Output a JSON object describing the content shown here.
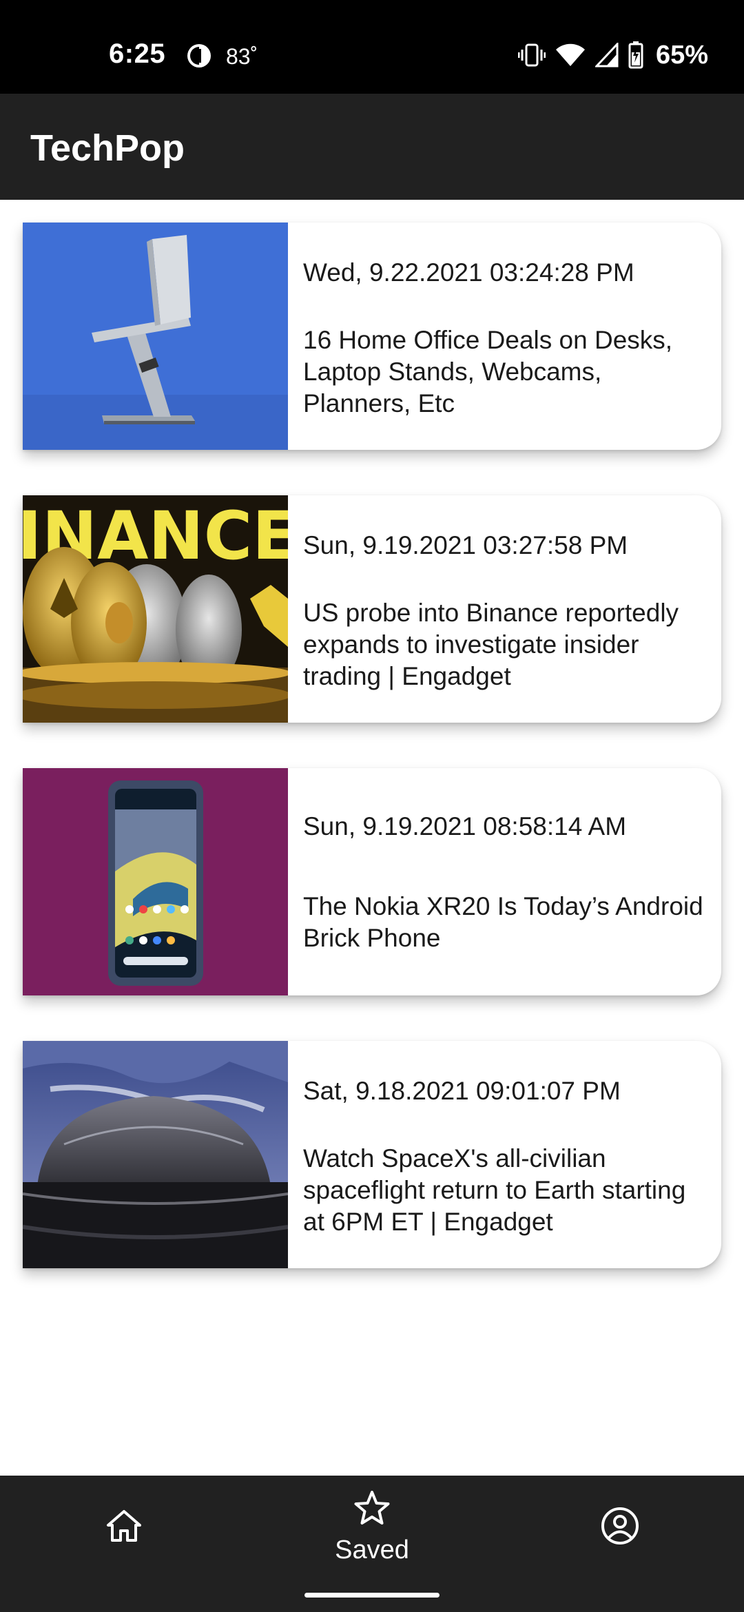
{
  "status_bar": {
    "time": "6:25",
    "temperature": "83˚",
    "battery_percent": "65%",
    "icons": [
      "weather-icon",
      "vibrate-icon",
      "wifi-icon",
      "signal-icon",
      "battery-icon"
    ]
  },
  "app_bar": {
    "title": "TechPop"
  },
  "articles": [
    {
      "date": "Wed, 9.22.2021 03:24:28 PM",
      "title": "16 Home Office Deals on Desks, Laptop Stands, Webcams, Planners, Etc",
      "thumbnail": "laptop-stand-image"
    },
    {
      "date": "Sun, 9.19.2021 03:27:58 PM",
      "title": "US probe into Binance reportedly expands to investigate insider trading | Engadget",
      "thumbnail": "binance-crypto-coins-image",
      "thumbnail_text": "INANCE"
    },
    {
      "date": "Sun, 9.19.2021 08:58:14 AM",
      "title": "The Nokia XR20 Is Today’s Android Brick Phone",
      "thumbnail": "nokia-phone-image"
    },
    {
      "date": "Sat, 9.18.2021 09:01:07 PM",
      "title": "Watch SpaceX's all-civilian spaceflight return to Earth starting at 6PM ET | Engadget",
      "thumbnail": "spacex-capsule-earth-image"
    }
  ],
  "bottom_nav": {
    "home_icon": "home-icon",
    "saved_icon": "star-icon",
    "saved_label": "Saved",
    "profile_icon": "account-circle-icon"
  },
  "colors": {
    "status_bar": "#000000",
    "app_bar": "#212121",
    "bottom_nav": "#212121",
    "background": "#ffffff",
    "text": "#1a1a1a",
    "thumb_laptop_bg": "#3f6fd6",
    "thumb_nokia_bg": "#7a1f5e"
  }
}
